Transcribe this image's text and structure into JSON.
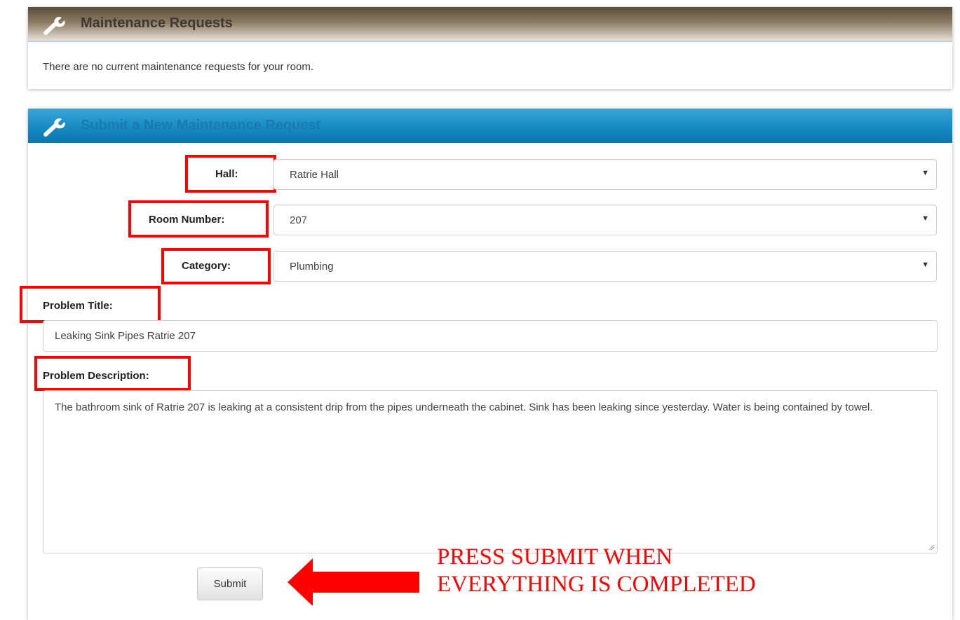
{
  "maintenance_panel": {
    "title": "Maintenance Requests",
    "icon": "wrench-icon",
    "message": "There are no current maintenance requests for your room."
  },
  "submit_panel": {
    "title": "Submit a New Maintenance Request",
    "icon": "wrench-icon"
  },
  "form": {
    "hall": {
      "label": "Hall:",
      "value": "Ratrie Hall"
    },
    "room": {
      "label": "Room Number:",
      "value": "207"
    },
    "category": {
      "label": "Category:",
      "value": "Plumbing"
    },
    "problem_title": {
      "label": "Problem Title:",
      "value": "Leaking Sink Pipes Ratrie 207"
    },
    "problem_description": {
      "label": "Problem Description:",
      "value": "The bathroom sink of Ratrie 207 is leaking at a consistent drip from the pipes underneath the cabinet. Sink has been leaking since yesterday. Water is being contained by towel."
    },
    "submit_label": "Submit"
  },
  "annotation": {
    "line1": "PRESS SUBMIT WHEN",
    "line2": "EVERYTHING IS COMPLETED",
    "highlight_color": "#ff0000"
  },
  "colors": {
    "brown_header": "#8c7b62",
    "blue_header": "#168bc3"
  }
}
